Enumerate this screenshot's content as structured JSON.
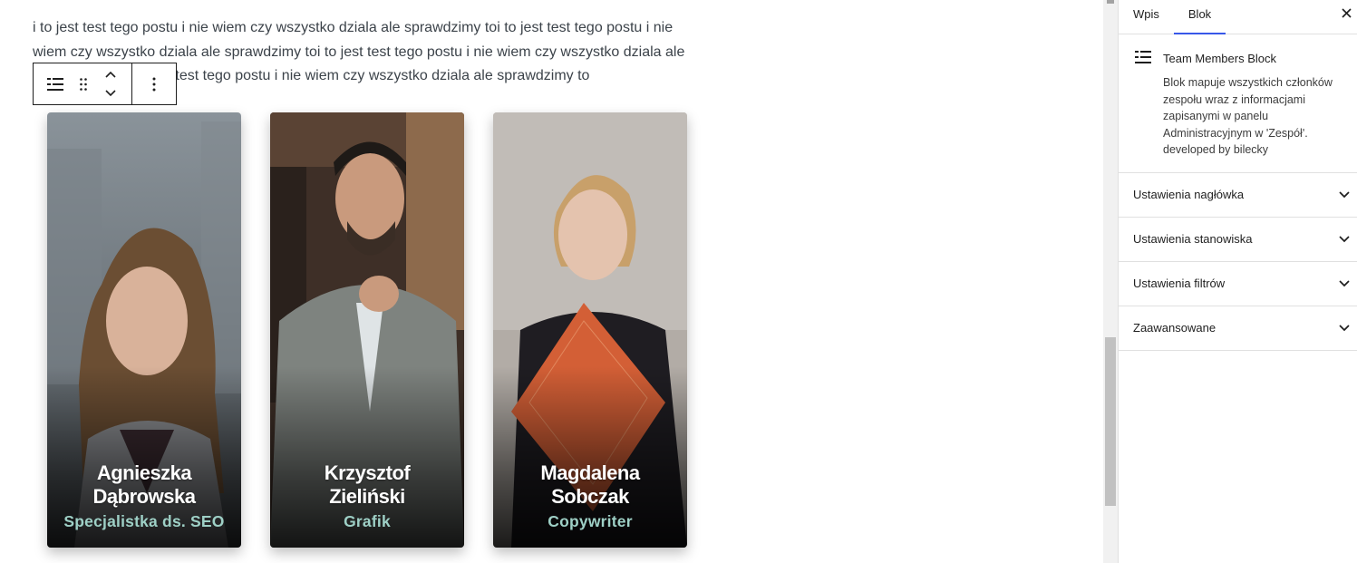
{
  "editor": {
    "paragraph_text": "i to jest test tego postu i nie wiem czy wszystko dziala ale sprawdzimy toi to jest test tego postu i nie wiem czy wszystko dziala ale sprawdzimy toi to jest test tego postu i nie wiem czy wszystko dziala ale sprawdzimy toi to jest test tego postu i nie wiem czy wszystko dziala ale sprawdzimy to"
  },
  "toolbar": {
    "block_type_icon": "team-members-block-icon",
    "drag_icon": "drag-handle-icon",
    "move_up_icon": "chevron-up-icon",
    "move_down_icon": "chevron-down-icon",
    "options_icon": "more-vertical-icon"
  },
  "team": {
    "accent_role_color": "#9ed0c6",
    "members": [
      {
        "name": "Agnieszka\nDąbrowska",
        "role": "Specjalistka ds. SEO"
      },
      {
        "name": "Krzysztof\nZieliński",
        "role": "Grafik"
      },
      {
        "name": "Magdalena\nSobczak",
        "role": "Copywriter"
      }
    ]
  },
  "sidebar": {
    "tabs": [
      {
        "label": "Wpis",
        "active": false
      },
      {
        "label": "Blok",
        "active": true
      }
    ],
    "close_icon": "close-icon",
    "block": {
      "title": "Team Members Block",
      "description": "Blok mapuje wszystkich członków zespołu wraz z informacjami zapisanymi w panelu Administracyjnym w 'Zespół'. developed by bilecky"
    },
    "panels": [
      {
        "label": "Ustawienia nagłówka"
      },
      {
        "label": "Ustawienia stanowiska"
      },
      {
        "label": "Ustawienia filtrów"
      },
      {
        "label": "Zaawansowane"
      }
    ],
    "accent_color": "#3858e9"
  }
}
